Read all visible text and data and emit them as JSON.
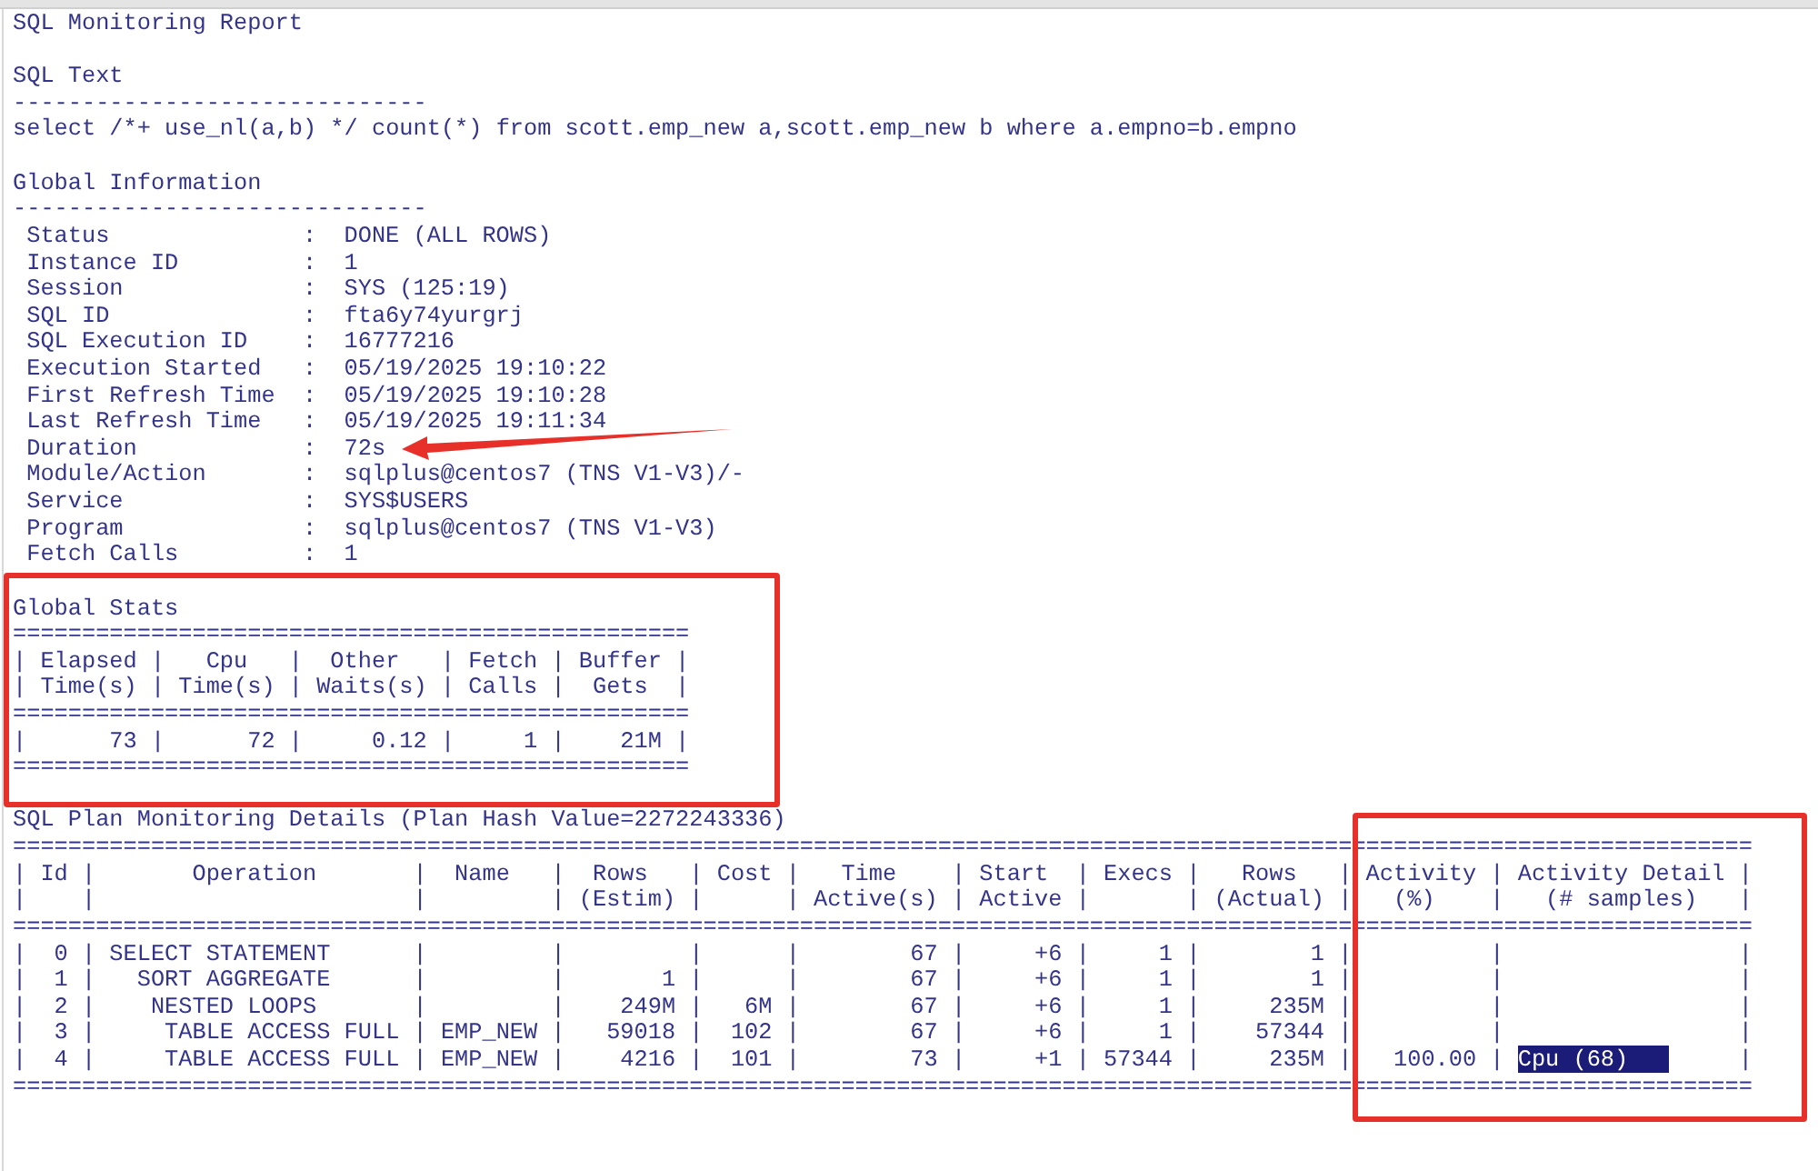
{
  "report_title": "SQL Monitoring Report",
  "sql_text": {
    "heading": "SQL Text",
    "rule": "------------------------------",
    "statement": "select /*+ use_nl(a,b) */ count(*) from scott.emp_new a,scott.emp_new b where a.empno=b.empno"
  },
  "global_information": {
    "heading": "Global Information",
    "rule": "------------------------------",
    "items": [
      {
        "label": "Status",
        "sep": ":",
        "value": "DONE (ALL ROWS)",
        "annotated": false
      },
      {
        "label": "Instance ID",
        "sep": ":",
        "value": "1",
        "annotated": false
      },
      {
        "label": "Session",
        "sep": ":",
        "value": "SYS (125:19)",
        "annotated": false
      },
      {
        "label": "SQL ID",
        "sep": ":",
        "value": "fta6y74yurgrj",
        "annotated": false
      },
      {
        "label": "SQL Execution ID",
        "sep": ":",
        "value": "16777216",
        "annotated": false
      },
      {
        "label": "Execution Started",
        "sep": ":",
        "value": "05/19/2025 19:10:22",
        "annotated": false
      },
      {
        "label": "First Refresh Time",
        "sep": ":",
        "value": "05/19/2025 19:10:28",
        "annotated": false
      },
      {
        "label": "Last Refresh Time",
        "sep": ":",
        "value": "05/19/2025 19:11:34",
        "annotated": false
      },
      {
        "label": "Duration",
        "sep": ":",
        "value": "72s",
        "annotated": true
      },
      {
        "label": "Module/Action",
        "sep": ":",
        "value": "sqlplus@centos7 (TNS V1-V3)/-",
        "annotated": false
      },
      {
        "label": "Service",
        "sep": ":",
        "value": "SYS$USERS",
        "annotated": false
      },
      {
        "label": "Program",
        "sep": ":",
        "value": "sqlplus@centos7 (TNS V1-V3)",
        "annotated": false
      },
      {
        "label": "Fetch Calls",
        "sep": ":",
        "value": "1",
        "annotated": false
      }
    ]
  },
  "global_stats": {
    "heading": "Global Stats",
    "highlighted": true,
    "lines": [
      {
        "text": "================================================="
      },
      {
        "text": "| Elapsed |   Cpu   |  Other   | Fetch | Buffer |"
      },
      {
        "text": "| Time(s) | Time(s) | Waits(s) | Calls |  Gets  |"
      },
      {
        "text": "================================================="
      },
      {
        "text": "|      73 |      72 |     0.12 |     1 |    21M |"
      },
      {
        "text": "================================================="
      }
    ]
  },
  "plan": {
    "heading": "SQL Plan Monitoring Details (Plan Hash Value=2272243336)",
    "activity_highlighted": true,
    "header_lines": [
      {
        "text": "=============================================================================================================================="
      },
      {
        "text": "| Id |       Operation       |  Name   |  Rows   | Cost |   Time    | Start  | Execs |   Rows   | Activity | Activity Detail |"
      },
      {
        "text": "|    |                       |         | (Estim) |      | Active(s) | Active |       | (Actual) |   (%)    |   (# samples)   |"
      },
      {
        "text": "=============================================================================================================================="
      }
    ],
    "rows": [
      {
        "main": "|  0 | SELECT STATEMENT      |         |         |      |        67 |     +6 |     1 |        1 |          |                 |",
        "sampled": false
      },
      {
        "main": "|  1 |   SORT AGGREGATE      |         |       1 |      |        67 |     +6 |     1 |        1 |          |                 |",
        "sampled": false
      },
      {
        "main": "|  2 |    NESTED LOOPS       |         |    249M |   6M |        67 |     +6 |     1 |     235M |          |                 |",
        "sampled": false
      },
      {
        "main": "|  3 |     TABLE ACCESS FULL | EMP_NEW |   59018 |  102 |        67 |     +6 |     1 |    57344 |          |                 |",
        "sampled": false
      },
      {
        "main": "|  4 |     TABLE ACCESS FULL | EMP_NEW |    4216 |  101 |        73 |     +1 | 57344 |     235M |   100.00 | ",
        "detail": "Cpu (68)",
        "tail": "     |",
        "sampled": true
      }
    ],
    "footer_rule": "=============================================================================================================================="
  }
}
